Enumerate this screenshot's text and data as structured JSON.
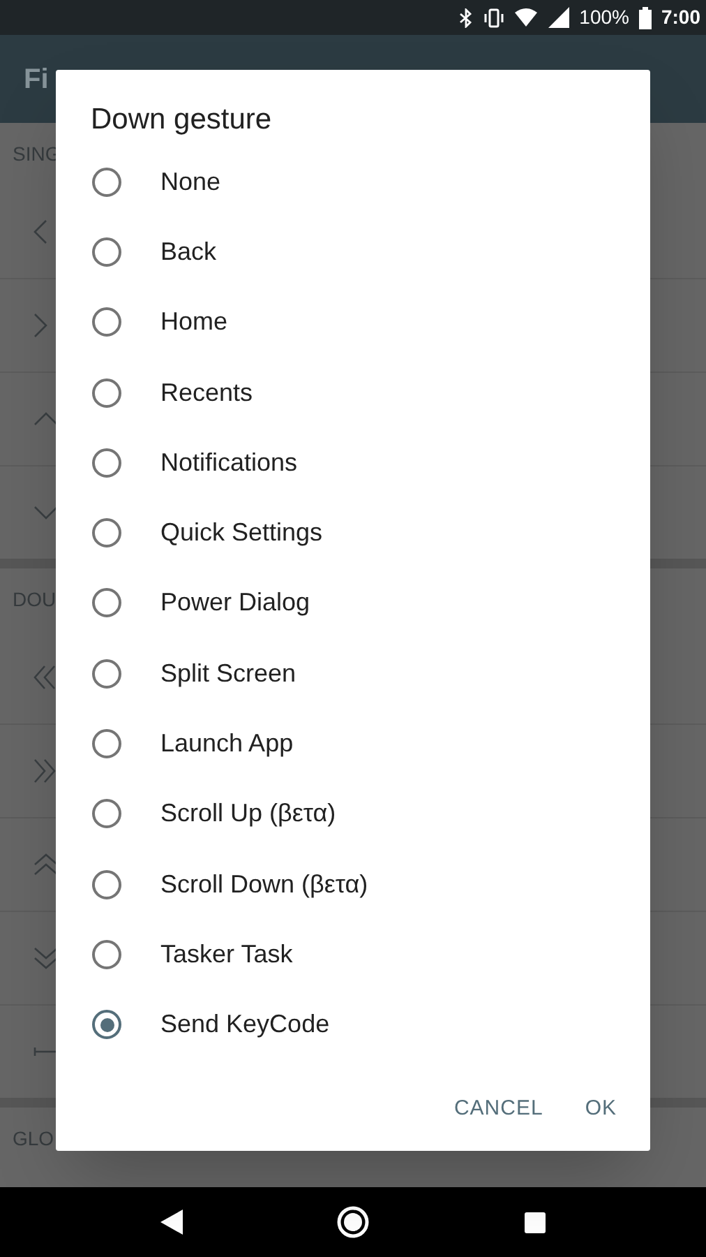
{
  "status_bar": {
    "battery": "100%",
    "time": "7:00"
  },
  "app_bar": {
    "title": "Fi"
  },
  "sections": [
    {
      "header": "SING",
      "rows": [
        {
          "kind": "left"
        },
        {
          "kind": "right"
        },
        {
          "kind": "up"
        },
        {
          "kind": "down"
        }
      ]
    },
    {
      "header": "DOU",
      "rows": [
        {
          "kind": "dleft"
        },
        {
          "kind": "dright"
        },
        {
          "kind": "dup"
        },
        {
          "kind": "ddown"
        },
        {
          "kind": "span"
        }
      ]
    },
    {
      "header": "GLO"
    }
  ],
  "dialog": {
    "title": "Down gesture",
    "options": [
      {
        "label": "None",
        "selected": false
      },
      {
        "label": "Back",
        "selected": false
      },
      {
        "label": "Home",
        "selected": false
      },
      {
        "label": "Recents",
        "selected": false
      },
      {
        "label": "Notifications",
        "selected": false
      },
      {
        "label": "Quick Settings",
        "selected": false
      },
      {
        "label": "Power Dialog",
        "selected": false
      },
      {
        "label": "Split Screen",
        "selected": false
      },
      {
        "label": "Launch App",
        "selected": false
      },
      {
        "label": "Scroll Up (βετα)",
        "selected": false
      },
      {
        "label": "Scroll Down (βετα)",
        "selected": false
      },
      {
        "label": "Tasker Task",
        "selected": false
      },
      {
        "label": "Send KeyCode",
        "selected": true
      }
    ],
    "buttons": [
      "CANCEL",
      "OK"
    ]
  }
}
